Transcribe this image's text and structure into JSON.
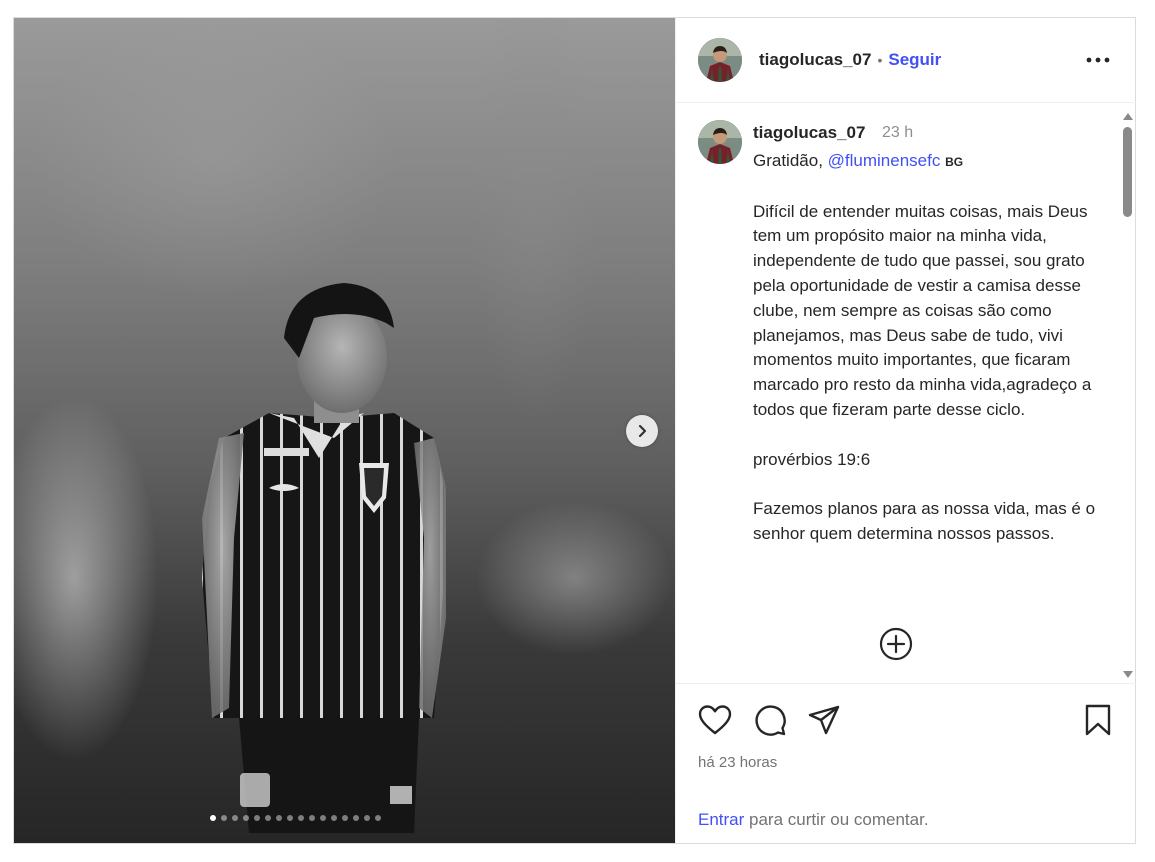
{
  "post": {
    "username": "tiagolucas_07",
    "follow_label": "Seguir",
    "separator": "•",
    "more_label": "⋯"
  },
  "media": {
    "slide_count": 16,
    "active_slide": 1,
    "next_label": "›"
  },
  "caption": {
    "username": "tiagolucas_07",
    "time": "23 h",
    "greeting": "Gratidão, ",
    "mention": "@fluminensefc",
    "tag": "BG",
    "body": "\n\nDifícil de entender muitas coisas, mais Deus tem um propósito maior na minha vida, independente de tudo que passei, sou grato pela oportunidade de vestir a camisa desse clube, nem sempre as coisas são como planejamos, mas Deus sabe de tudo, vivi momentos muito importantes, que ficaram marcado pro resto da minha vida,agradeço a todos que fizeram parte desse ciclo.\n\nprovérbios 19:6\n\nFazemos planos para as nossa vida, mas é o senhor quem determina nossos passos."
  },
  "footer": {
    "time_ago": "há 23 horas",
    "login_link": "Entrar",
    "login_rest": " para curtir ou comentar."
  },
  "colors": {
    "link": "#4150f7",
    "text": "#262626",
    "muted": "#737373"
  }
}
